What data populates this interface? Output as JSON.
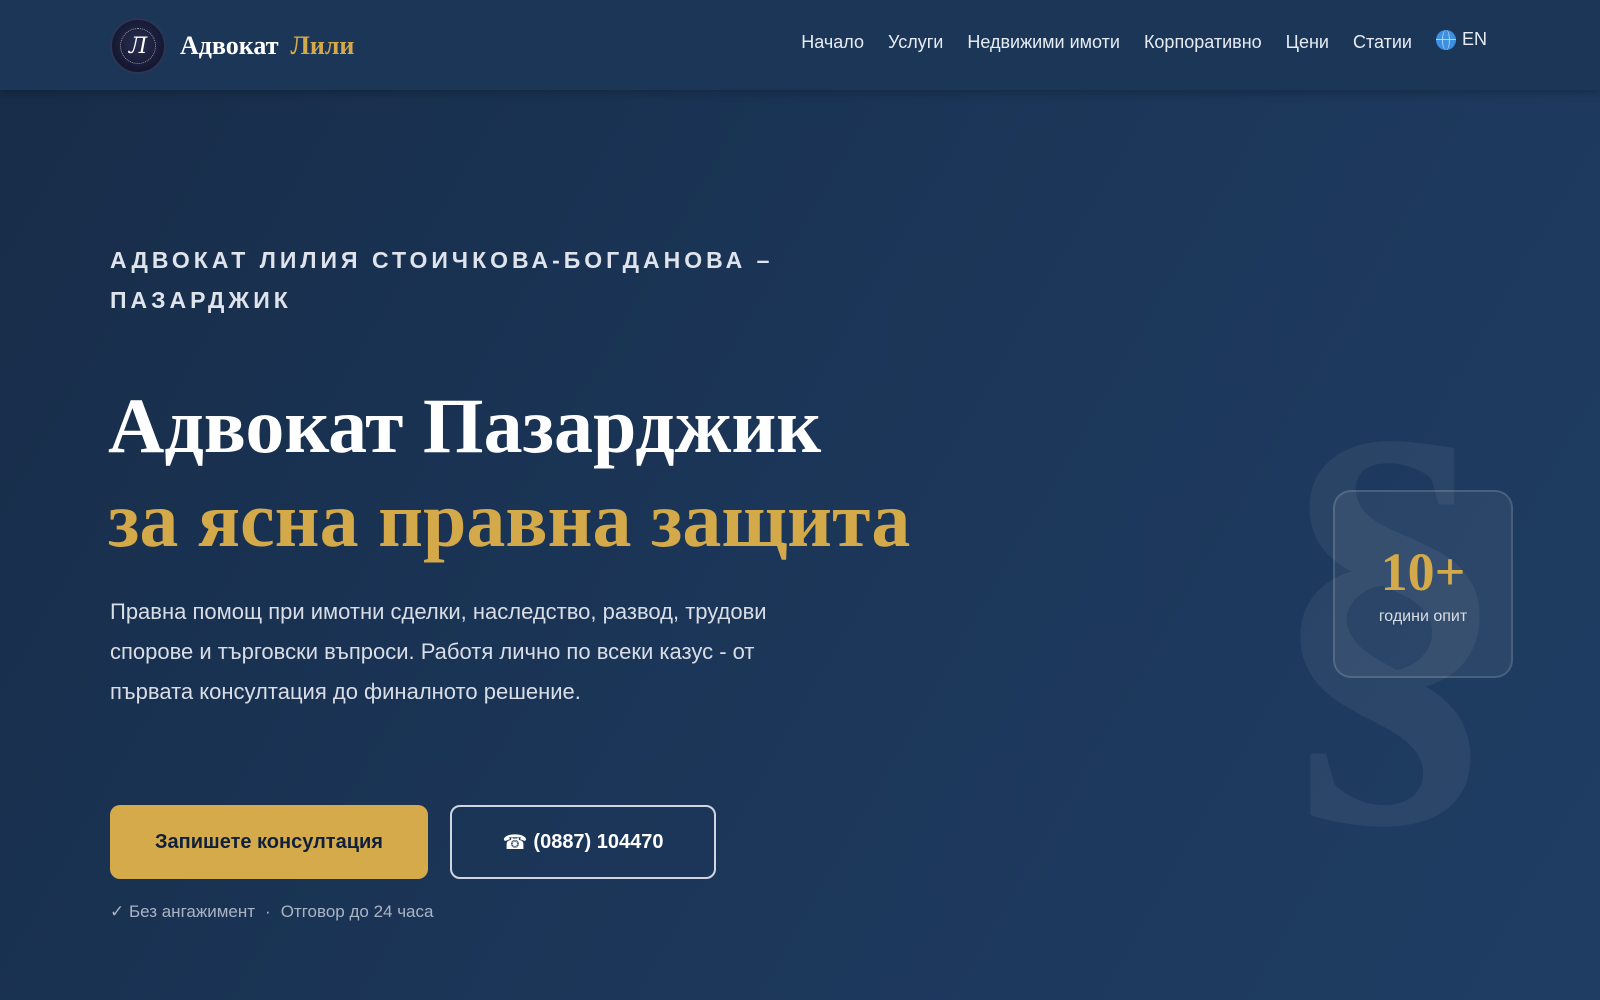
{
  "header": {
    "logo_letter": "Л",
    "brand_name": "Адвокат",
    "brand_accent": "Лили",
    "nav": [
      {
        "label": "Начало"
      },
      {
        "label": "Услуги"
      },
      {
        "label": "Недвижими имоти"
      },
      {
        "label": "Корпоративно"
      },
      {
        "label": "Цени"
      },
      {
        "label": "Статии"
      }
    ],
    "language": "EN",
    "language_icon": "globe-icon"
  },
  "hero": {
    "eyebrow": "Адвокат Лилия Стоичкова-Богданова – Пазарджик",
    "title_line1": "Адвокат Пазарджик",
    "title_line2": "за ясна правна защита",
    "lead": "Правна помощ при имотни сделки, наследство, развод, трудови спорове и търговски въпроси. Работя лично по всеки казус - от първата консултация до финалното решение.",
    "cta_primary": "Запишете консултация",
    "phone_icon": "☎",
    "cta_phone": "(0887) 104470",
    "trust_1": "✓ Без ангажимент",
    "trust_sep": "·",
    "trust_2": "Отговор до 24 часа"
  },
  "stat": {
    "value": "10+",
    "label": "години опит",
    "decor_symbol": "§"
  },
  "colors": {
    "accent_gold": "#d4a94a",
    "navy": "#1c3657"
  }
}
